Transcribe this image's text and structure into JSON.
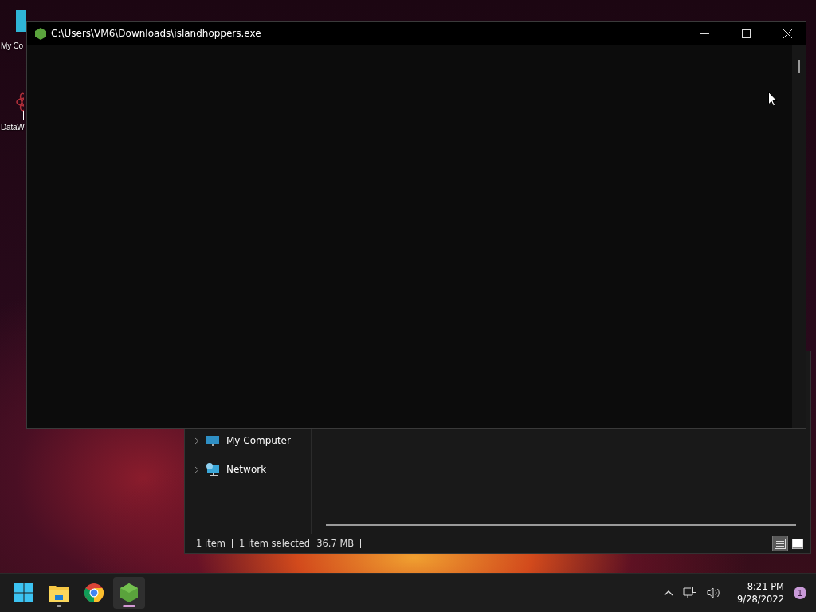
{
  "desktop": {
    "icons": [
      {
        "kind": "computer",
        "label": "My Co"
      },
      {
        "kind": "shortcut",
        "label": "DataW"
      }
    ]
  },
  "explorer": {
    "nav_items": [
      {
        "kind": "computer",
        "label": "My Computer"
      },
      {
        "kind": "network",
        "label": "Network"
      }
    ],
    "status_bar": {
      "item_count": "1 item",
      "selection": "1 item selected",
      "size": "36.7 MB"
    },
    "view_buttons": [
      {
        "kind": "details",
        "selected": true
      },
      {
        "kind": "large-icons",
        "selected": false
      }
    ]
  },
  "console": {
    "title": "C:\\Users\\VM6\\Downloads\\islandhoppers.exe"
  },
  "taskbar": {
    "apps": [
      {
        "kind": "start",
        "running": false,
        "active": false
      },
      {
        "kind": "explorer",
        "running": true,
        "active": false
      },
      {
        "kind": "chrome",
        "running": false,
        "active": false
      },
      {
        "kind": "cube",
        "running": true,
        "active": true
      }
    ],
    "tray": {
      "time": "8:21 PM",
      "date": "9/28/2022",
      "notifications": "1"
    }
  }
}
